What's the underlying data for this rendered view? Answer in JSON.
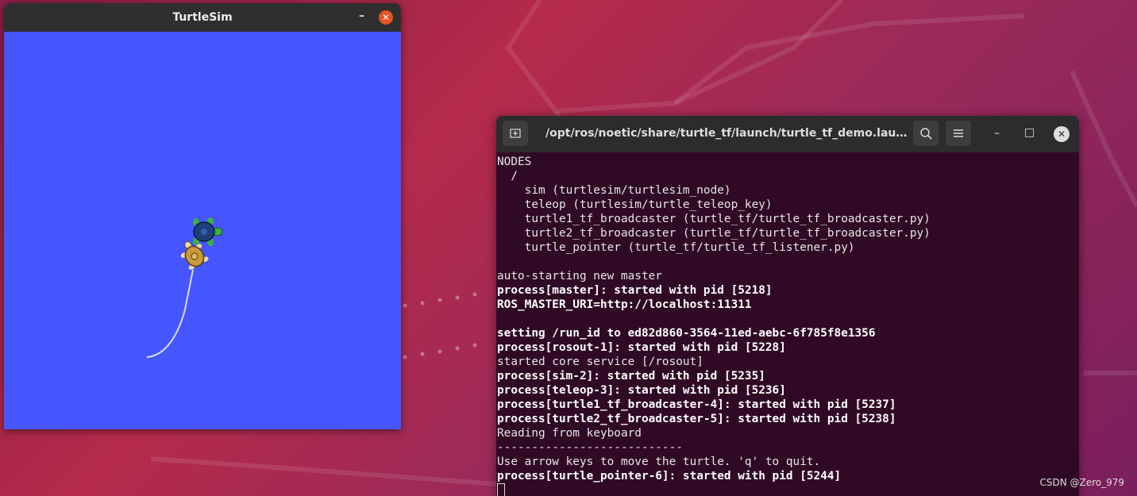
{
  "turtlesim": {
    "title": "TurtleSim",
    "minimize": "–",
    "close": "✕",
    "background_color": "#4556ff"
  },
  "terminal": {
    "title": "/opt/ros/noetic/share/turtle_tf/launch/turtle_tf_demo.laun...",
    "icons": [
      "new-tab-icon",
      "search-icon",
      "menu-icon",
      "minimize-icon",
      "maximize-icon",
      "close-icon"
    ],
    "minimize": "–",
    "maximize": "□",
    "close": "✕",
    "lines": [
      {
        "text": "NODES",
        "bold": false
      },
      {
        "text": "  /",
        "bold": false
      },
      {
        "text": "    sim (turtlesim/turtlesim_node)",
        "bold": false
      },
      {
        "text": "    teleop (turtlesim/turtle_teleop_key)",
        "bold": false
      },
      {
        "text": "    turtle1_tf_broadcaster (turtle_tf/turtle_tf_broadcaster.py)",
        "bold": false
      },
      {
        "text": "    turtle2_tf_broadcaster (turtle_tf/turtle_tf_broadcaster.py)",
        "bold": false
      },
      {
        "text": "    turtle_pointer (turtle_tf/turtle_tf_listener.py)",
        "bold": false
      },
      {
        "text": "",
        "bold": false
      },
      {
        "text": "auto-starting new master",
        "bold": false
      },
      {
        "text": "process[master]: started with pid [5218]",
        "bold": true
      },
      {
        "text": "ROS_MASTER_URI=http://localhost:11311",
        "bold": true
      },
      {
        "text": "",
        "bold": false
      },
      {
        "text": "setting /run_id to ed82d860-3564-11ed-aebc-6f785f8e1356",
        "bold": true
      },
      {
        "text": "process[rosout-1]: started with pid [5228]",
        "bold": true
      },
      {
        "text": "started core service [/rosout]",
        "bold": false
      },
      {
        "text": "process[sim-2]: started with pid [5235]",
        "bold": true
      },
      {
        "text": "process[teleop-3]: started with pid [5236]",
        "bold": true
      },
      {
        "text": "process[turtle1_tf_broadcaster-4]: started with pid [5237]",
        "bold": true
      },
      {
        "text": "process[turtle2_tf_broadcaster-5]: started with pid [5238]",
        "bold": true
      },
      {
        "text": "Reading from keyboard",
        "bold": false
      },
      {
        "text": "---------------------------",
        "bold": false
      },
      {
        "text": "Use arrow keys to move the turtle. 'q' to quit.",
        "bold": false
      },
      {
        "text": "process[turtle_pointer-6]: started with pid [5244]",
        "bold": true
      }
    ]
  },
  "watermark": "CSDN @Zero_979"
}
